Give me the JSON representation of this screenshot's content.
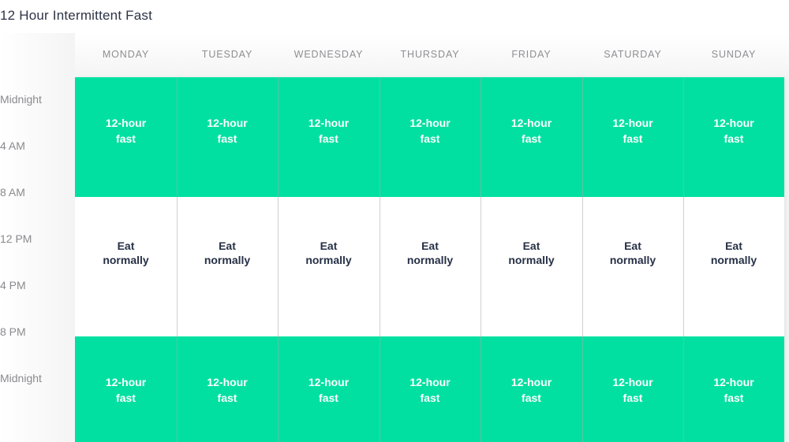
{
  "page": {
    "title": "12 Hour Intermittent Fast"
  },
  "colors": {
    "fast": "#02e0a1",
    "eat": "#ffffff",
    "fast_text": "#ffffff",
    "eat_text": "#263046",
    "header_text": "#8f8f93"
  },
  "days": [
    "MONDAY",
    "TUESDAY",
    "WEDNESDAY",
    "THURSDAY",
    "FRIDAY",
    "SATURDAY",
    "SUNDAY"
  ],
  "time_labels": [
    "Midnight",
    "4 AM",
    "8 AM",
    "12 PM",
    "4 PM",
    "8 PM",
    "Midnight"
  ],
  "schedule": {
    "top_band": {
      "label": "12-hour fast",
      "type": "fast"
    },
    "middle_band": {
      "label": "Eat normally",
      "type": "eat"
    },
    "bottom_band": {
      "label": "12-hour fast",
      "type": "fast"
    }
  }
}
